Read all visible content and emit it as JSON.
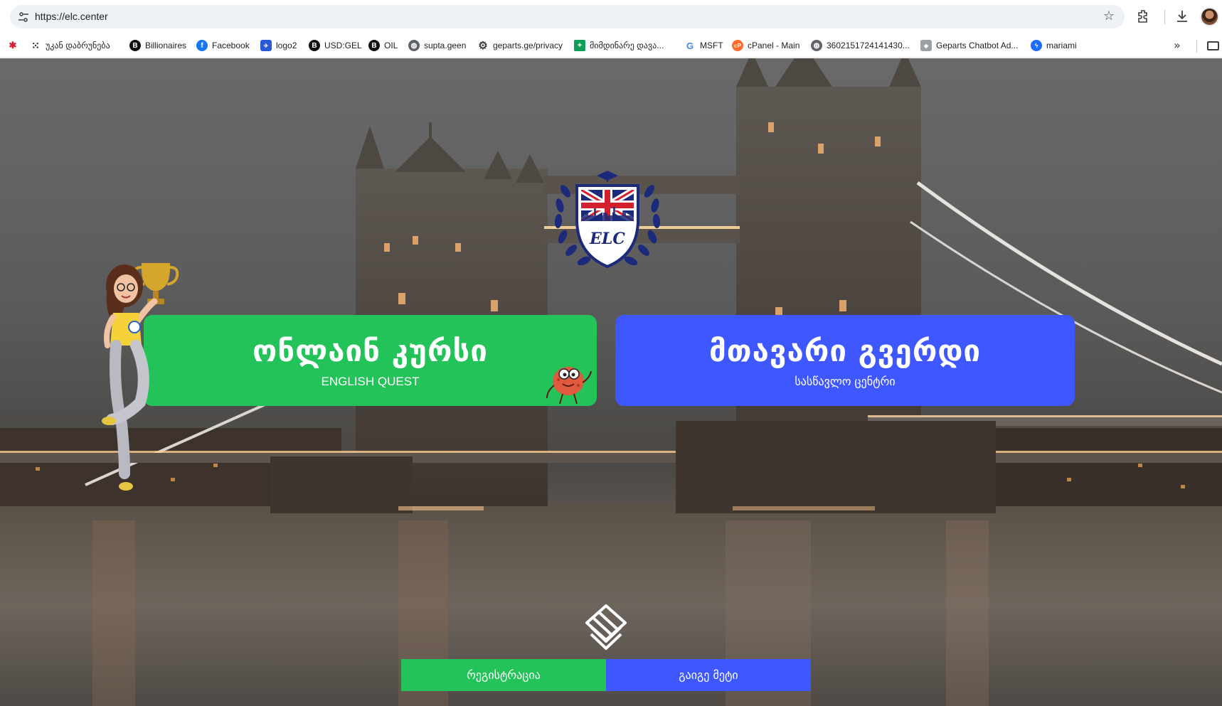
{
  "browser": {
    "url": "https://elc.center"
  },
  "bookmarks": {
    "items": [
      {
        "label": "",
        "icon": "crab-icon"
      },
      {
        "label": "უკან დაბრუნება",
        "icon": "grid-icon"
      },
      {
        "label": "Billionaires",
        "icon": "b-circle-icon"
      },
      {
        "label": "Facebook",
        "icon": "facebook-icon"
      },
      {
        "label": "logo2",
        "icon": "logo-icon"
      },
      {
        "label": "USD:GEL",
        "icon": "b-circle-icon"
      },
      {
        "label": "OIL",
        "icon": "b-circle-icon"
      },
      {
        "label": "supta.geen",
        "icon": "globe-icon"
      },
      {
        "label": "geparts.ge/privacy",
        "icon": "gear-icon"
      },
      {
        "label": "მიმდინარე დავა...",
        "icon": "sheets-icon"
      },
      {
        "label": "MSFT",
        "icon": "google-icon"
      },
      {
        "label": "cPanel - Main",
        "icon": "cpanel-icon"
      },
      {
        "label": "3602151724141430...",
        "icon": "globe-icon"
      },
      {
        "label": "Geparts Chatbot Ad...",
        "icon": "chatbot-icon"
      },
      {
        "label": "mariami",
        "icon": "messenger-icon"
      }
    ]
  },
  "hero": {
    "online_course": {
      "title": "ონლაინ კურსი",
      "subtitle": "ENGLISH QUEST"
    },
    "main_page": {
      "title": "მთავარი გვერდი",
      "subtitle": "სასწავლო ცენტრი"
    }
  },
  "logo": {
    "text": "ELC"
  },
  "footer_buttons": {
    "register": "რეგისტრაცია",
    "learn_more": "გაიგე მეტი"
  },
  "colors": {
    "green": "#23c35a",
    "blue": "#3e57ff",
    "logo_navy": "#1b2a7a",
    "union_red": "#d3202f"
  }
}
